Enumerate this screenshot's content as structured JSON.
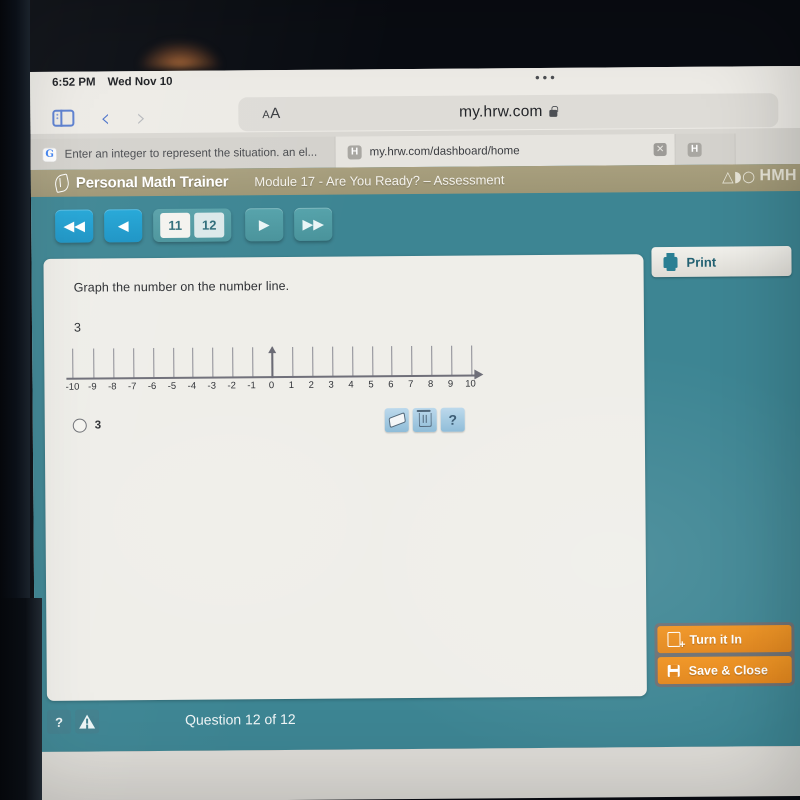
{
  "device": {
    "status_time": "6:52 PM",
    "status_date": "Wed Nov 10"
  },
  "browser": {
    "sidebar_icon": "sidebar-icon",
    "back_icon": "chevron-left-icon",
    "forward_icon": "chevron-right-icon",
    "text_size_label": "AA",
    "url": "my.hrw.com",
    "lock_icon": "lock-icon",
    "more_icon": "ellipsis-icon",
    "tabs": [
      {
        "favicon": "google-icon",
        "title": "Enter an integer to represent the situation. an el..."
      },
      {
        "favicon": "hmh-icon",
        "title": "my.hrw.com/dashboard/home",
        "close_label": "✕"
      },
      {
        "favicon": "hmh-icon",
        "title": ""
      }
    ]
  },
  "app": {
    "brand": "Personal Math Trainer",
    "brand_icon": "leaf-icon",
    "module_title": "Module 17 - Are You Ready? – Assessment",
    "logo_glyphs": "△◗○",
    "logo_text": "HMH"
  },
  "nav": {
    "first_label": "◀◀",
    "prev_label": "◀",
    "next_label": "▶",
    "last_label": "▶▶",
    "pages": [
      "11",
      "12"
    ]
  },
  "question": {
    "prompt": "Graph the number on the number line.",
    "value": "3",
    "answer_label": "3",
    "radio_state": "unselected"
  },
  "tools": [
    {
      "name": "eraser-tool",
      "label": ""
    },
    {
      "name": "delete-tool",
      "label": ""
    },
    {
      "name": "help-tool",
      "label": "?"
    }
  ],
  "sidebar": {
    "print_label": "Print",
    "print_icon": "printer-icon",
    "turn_in_label": "Turn it In",
    "turn_in_icon": "submit-document-icon",
    "save_close_label": "Save & Close",
    "save_close_icon": "floppy-disk-icon"
  },
  "footer": {
    "help_label": "?",
    "warning_icon": "warning-icon",
    "question_counter": "Question 12 of 12"
  },
  "colors": {
    "app_teal": "#3d8593",
    "header_tan": "#a89f7e",
    "accent_blue": "#23a7d8",
    "orange": "#f0931f",
    "panel": "#efeee9"
  },
  "chart_data": {
    "type": "numberline",
    "title": "Number line -10 to 10",
    "min": -10,
    "max": 10,
    "step": 1,
    "tick_labels": [
      "-10",
      "-9",
      "-8",
      "-7",
      "-6",
      "-5",
      "-4",
      "-3",
      "-2",
      "-1",
      "0",
      "1",
      "2",
      "3",
      "4",
      "5",
      "6",
      "7",
      "8",
      "9",
      "10"
    ],
    "cursor_at": 0,
    "plotted_points": [],
    "target_value": 3,
    "grid": true,
    "axis_arrow": "right"
  }
}
